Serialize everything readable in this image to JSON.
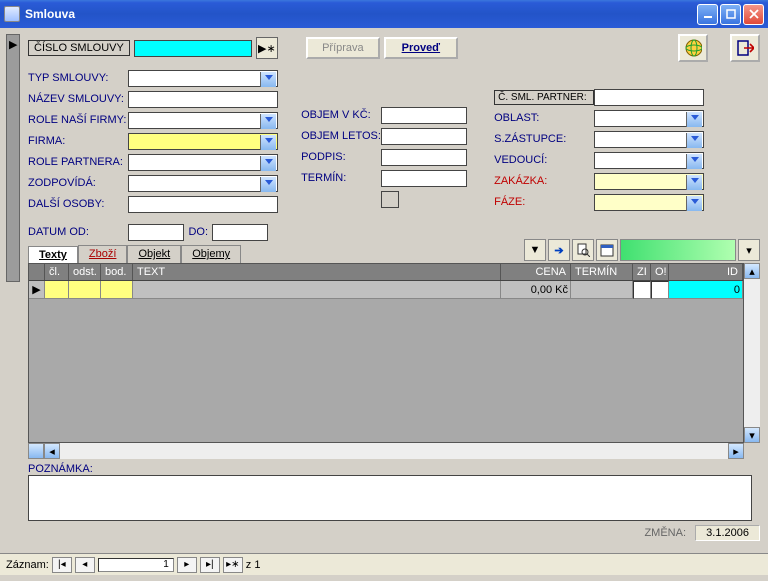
{
  "window": {
    "title": "Smlouva"
  },
  "toolbar": {
    "priprava": "Příprava",
    "proved": "Proveď"
  },
  "labels": {
    "cislo": "ČÍSLO SMLOUVY",
    "typ": "TYP SMLOUVY:",
    "nazev": "NÁZEV SMLOUVY:",
    "role_nasi": "ROLE NAŠÍ FIRMY:",
    "firma": "FIRMA:",
    "role_part": "ROLE PARTNERA:",
    "zodpovida": "ZODPOVÍDÁ:",
    "dalsi": "DALŠÍ OSOBY:",
    "datum_od": "DATUM OD:",
    "do": "DO:",
    "objem_kc": "OBJEM V KČ:",
    "objem_letos": "OBJEM LETOS:",
    "podpis": "PODPIS:",
    "termin": "TERMÍN:",
    "c_sml_partner": "Č. SML. PARTNER:",
    "oblast": "OBLAST:",
    "szastupce": "S.ZÁSTUPCE:",
    "vedouci": "VEDOUCÍ:",
    "zakazka": "ZAKÁZKA:",
    "faze": "FÁZE:",
    "poznamka": "POZNÁMKA:",
    "zmena": "ZMĚNA:"
  },
  "tabs": {
    "texty": "Texty",
    "zbozi": "Zboží",
    "objekt": "Objekt",
    "objemy": "Objemy"
  },
  "grid": {
    "headers": {
      "cl": "čl.",
      "odst": "odst.",
      "bod": "bod.",
      "text": "TEXT",
      "cena": "CENA",
      "termin": "TERMÍN",
      "zi": "ZI",
      "ot": "O!",
      "id": "ID"
    },
    "row": {
      "cena": "0,00 Kč",
      "id": "0"
    }
  },
  "footer": {
    "zmena_date": "3.1.2006"
  },
  "status": {
    "zaznam": "Záznam:",
    "pos": "1",
    "total": "z  1"
  }
}
